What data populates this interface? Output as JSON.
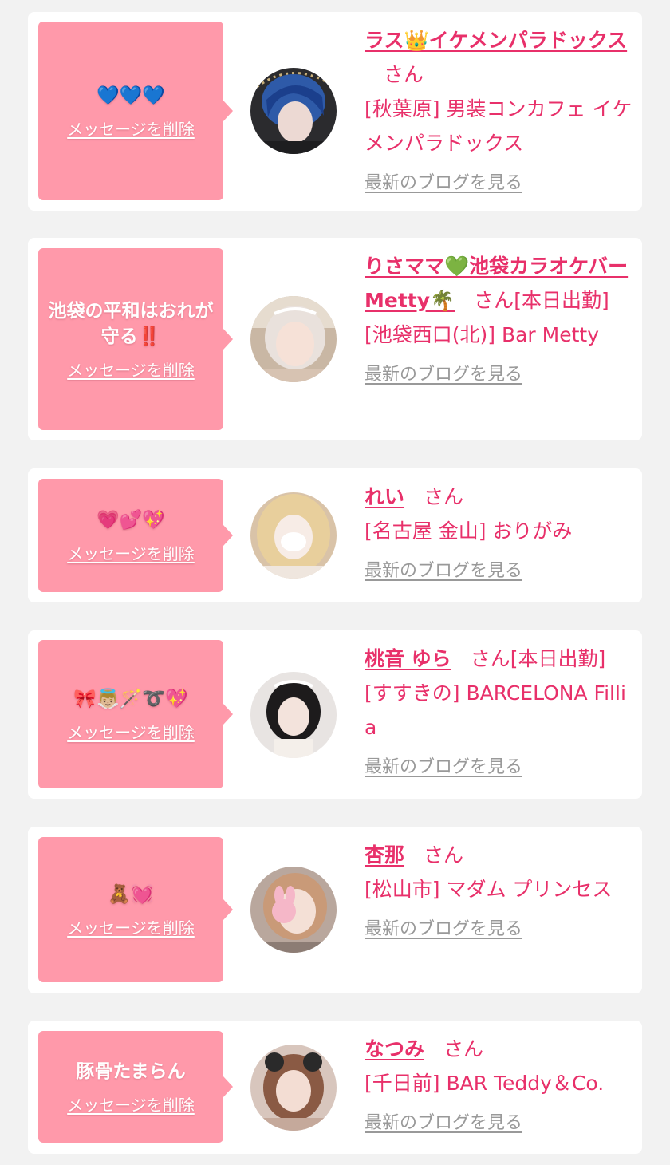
{
  "colors": {
    "page_background": "#f2f2f2",
    "card_background": "#ffffff",
    "bubble_pink": "#ff99aa",
    "accent_pink": "#e8306a",
    "link_gray": "#999999"
  },
  "labels": {
    "delete_message": "メッセージを削除",
    "view_blog": "最新のブログを見る",
    "honorific": "さん"
  },
  "entries": [
    {
      "message": "💙💙💙",
      "name": "ラス👑イケメンパラドックス",
      "status": "",
      "shop": "[秋葉原] 男装コンカフェ イケメンパラドックス",
      "avatar_icon": "profile-photo"
    },
    {
      "message": "池袋の平和はおれが守る‼️",
      "name": "りさママ💚池袋カラオケバーMetty🌴",
      "status": "[本日出勤]",
      "shop": "[池袋西口(北)] Bar Metty",
      "avatar_icon": "profile-photo"
    },
    {
      "message": "💗💕💖",
      "name": "れい",
      "status": "",
      "shop": "[名古屋 金山] おりがみ",
      "avatar_icon": "profile-photo"
    },
    {
      "message": "🎀👼🏼🪄➰💖",
      "name": "桃音 ゆら",
      "status": "[本日出勤]",
      "shop": "[すすきの] BARCELONA Fillia",
      "avatar_icon": "profile-photo"
    },
    {
      "message": "🧸💓",
      "name": "杏那",
      "status": "",
      "shop": "[松山市] マダム プリンセス",
      "avatar_icon": "profile-photo"
    },
    {
      "message": "豚骨たまらん",
      "name": "なつみ",
      "status": "",
      "shop": "[千日前] BAR Teddy＆Co.",
      "avatar_icon": "profile-photo"
    }
  ]
}
